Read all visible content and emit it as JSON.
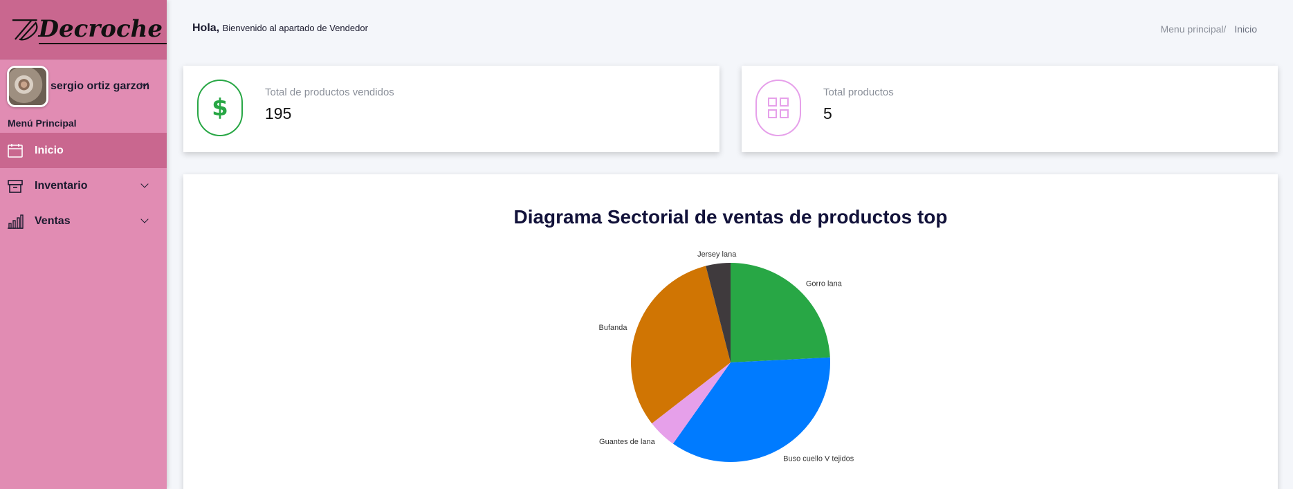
{
  "brand": {
    "name": "Decroche"
  },
  "user": {
    "name": "sergio ortiz garzon"
  },
  "sidebar": {
    "header": "Menú Principal",
    "items": [
      {
        "label": "Inicio",
        "icon": "calendar-icon",
        "active": true
      },
      {
        "label": "Inventario",
        "icon": "archive-box-icon",
        "active": false
      },
      {
        "label": "Ventas",
        "icon": "bar-chart-icon",
        "active": false
      }
    ]
  },
  "topbar": {
    "greeting_bold": "Hola,",
    "greeting_text": "Bienvenido al apartado de Vendedor",
    "breadcrumb_parent": "Menu principal/",
    "breadcrumb_current": "Inicio"
  },
  "stats": [
    {
      "label": "Total de productos vendidos",
      "value": "195",
      "icon": "dollar-icon",
      "color": "#28a745"
    },
    {
      "label": "Total productos",
      "value": "5",
      "icon": "grid-icon",
      "color": "#e6a0ea"
    }
  ],
  "colors": {
    "sidebar_bg": "#e18cb3",
    "sidebar_active": "#c9678f"
  },
  "chart_data": {
    "type": "pie",
    "title": "Diagrama Sectorial de ventas de productos top",
    "slices": [
      {
        "label": "Gorro lana",
        "value": 24.2,
        "color": "#28a745"
      },
      {
        "label": "Buso cuello V tejidos",
        "value": 35.6,
        "color": "#007bff"
      },
      {
        "label": "Guantes de lana",
        "value": 4.7,
        "color": "#e6a0ea"
      },
      {
        "label": "Bufanda",
        "value": 31.5,
        "color": "#d07503"
      },
      {
        "label": "Jersey lana",
        "value": 4.0,
        "color": "#3f3a3d"
      }
    ]
  }
}
